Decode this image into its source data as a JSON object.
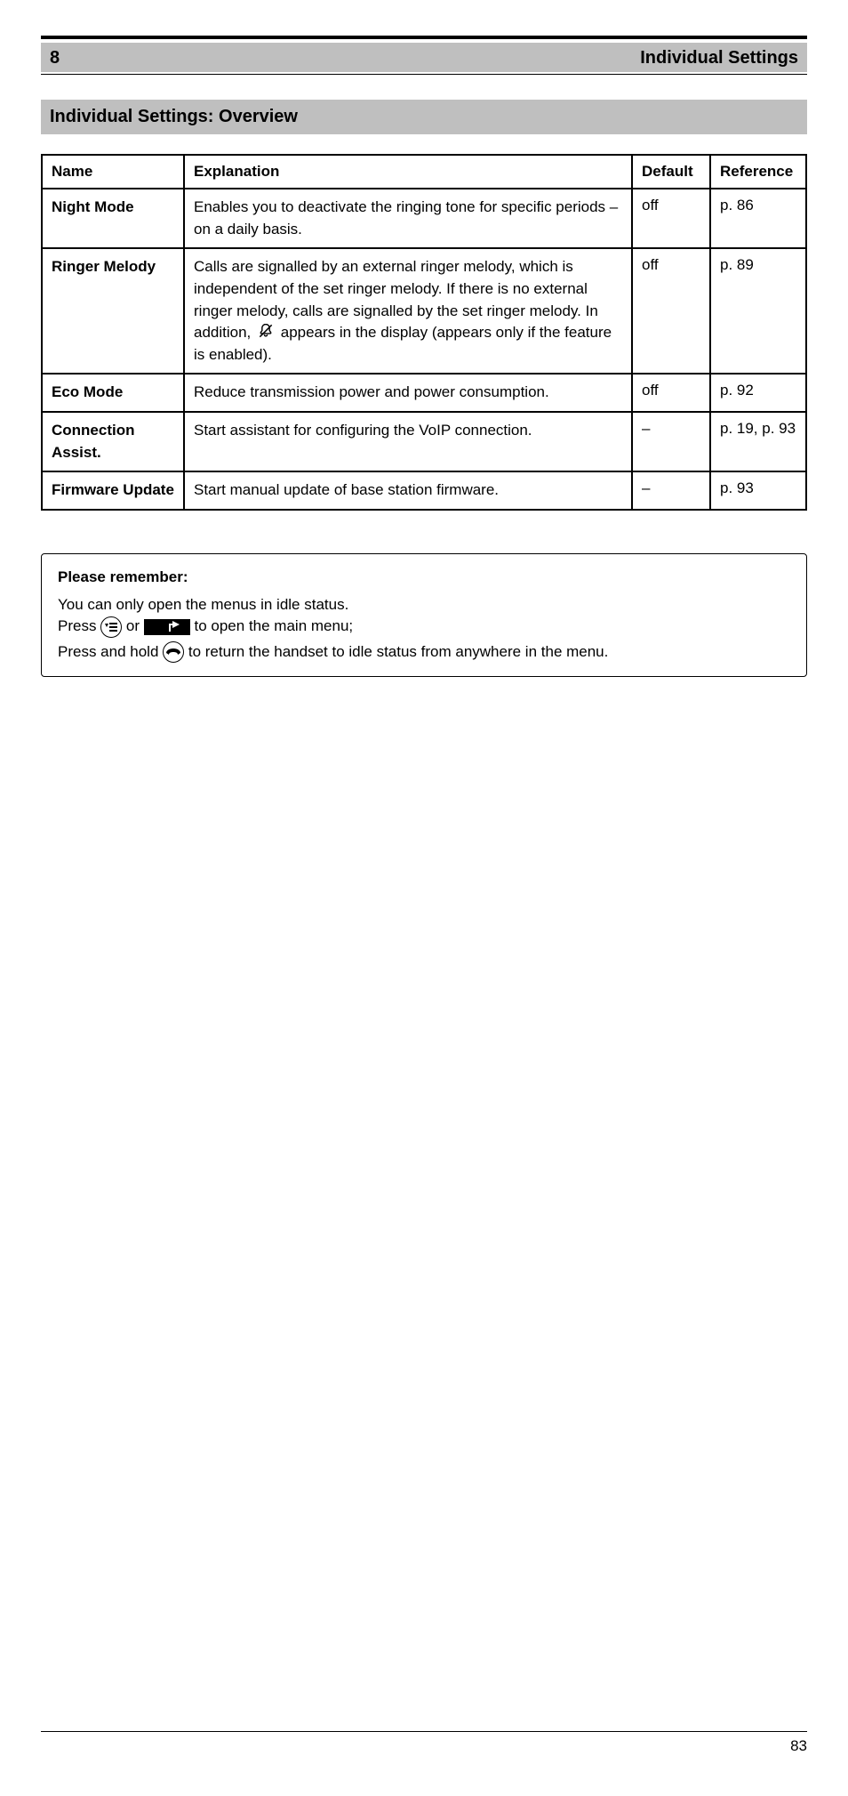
{
  "header": {
    "chapter_label": "8",
    "chapter_title": "Individual Settings",
    "section_title": "Individual Settings: Overview"
  },
  "table": {
    "headers": [
      "Name",
      "Explanation",
      "Default",
      "Reference"
    ],
    "rows": [
      {
        "name": "Night Mode",
        "expl": "Enables you to deactivate the ringing tone for specific periods – on a daily basis.",
        "def": "off",
        "ref": "p. 86"
      },
      {
        "name": "Ringer Melody",
        "expl_pre": "Calls are signalled by an external ringer melody, which is independent of the set ringer melody. If there is no external ringer melody, calls are signalled by the set ringer melody. In addition, ",
        "expl_post": " appears in the display (appears only if the feature is enabled).",
        "def": "off",
        "ref": "p. 89"
      },
      {
        "name": "Eco Mode",
        "expl": "Reduce transmission power and power consumption.",
        "def": "off",
        "ref": "p. 92"
      },
      {
        "name": "Connection Assist.",
        "expl": "Start assistant for configuring the VoIP connection.",
        "def": "–",
        "ref": "p. 19, p. 93"
      },
      {
        "name": "Firmware Update",
        "expl": "Start manual update of base station firmware.",
        "def": "–",
        "ref": "p. 93"
      }
    ]
  },
  "note": {
    "title": "Please remember:",
    "line1": "You can only open the menus in idle status.",
    "line2_pre": "Press ",
    "line2_mid": " or ",
    "line2_post": " to open the main menu;",
    "line3_pre": "Press and hold ",
    "line3_post": " to return the handset to idle status from anywhere in the menu."
  },
  "footer": {
    "right": "83"
  }
}
